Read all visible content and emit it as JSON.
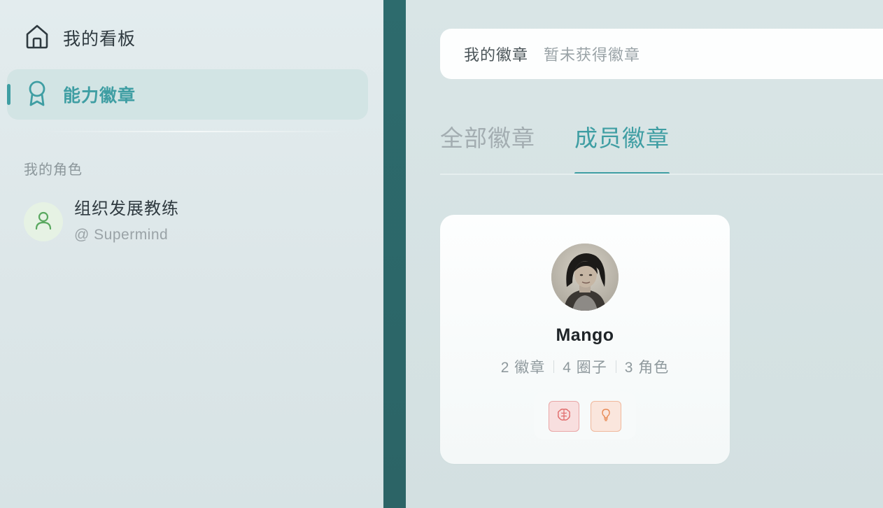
{
  "sidebar": {
    "nav": [
      {
        "label": "我的看板",
        "icon": "home-icon"
      },
      {
        "label": "能力徽章",
        "icon": "award-ribbon-icon",
        "active": true
      }
    ],
    "section_title": "我的角色",
    "role": {
      "name": "组织发展教练",
      "org": "@ Supermind",
      "icon": "user-icon"
    }
  },
  "main": {
    "my_badges": {
      "label": "我的徽章",
      "value": "暂未获得徽章"
    },
    "tabs": [
      {
        "label": "全部徽章",
        "active": false
      },
      {
        "label": "成员徽章",
        "active": true
      }
    ],
    "member_card": {
      "name": "Mango",
      "stats": [
        "2 徽章",
        "4 圈子",
        "3 角色"
      ],
      "badges": [
        {
          "icon": "brain-icon",
          "color": "#e06a6a"
        },
        {
          "icon": "lightbulb-icon",
          "color": "#e88a55"
        }
      ]
    }
  },
  "colors": {
    "accent": "#3f9ea3",
    "strip": "#2d6b6d",
    "sidebar_bg": "#dfe9ea"
  }
}
